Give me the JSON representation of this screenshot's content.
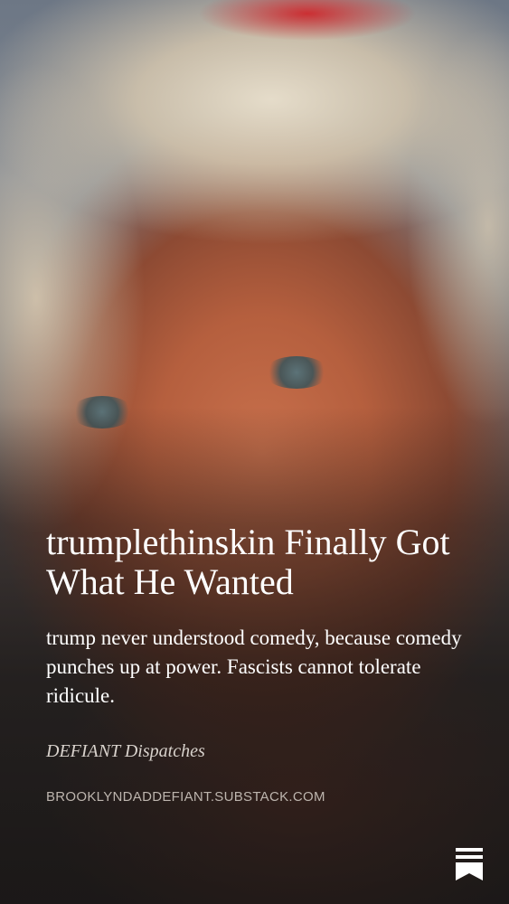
{
  "post": {
    "title": "trumplethinskin Finally Got What He Wanted",
    "subtitle": "trump never understood comedy, because comedy punches up at power. Fascists cannot tolerate ridicule.",
    "publication": "DEFIANT Dispatches",
    "url": "BROOKLYNDADDEFIANT.SUBSTACK.COM"
  },
  "icons": {
    "logo": "substack-bookmark-icon"
  },
  "colors": {
    "text_primary": "#ffffff",
    "text_secondary": "#d8d2cc",
    "url_text": "#bdb5ae"
  }
}
